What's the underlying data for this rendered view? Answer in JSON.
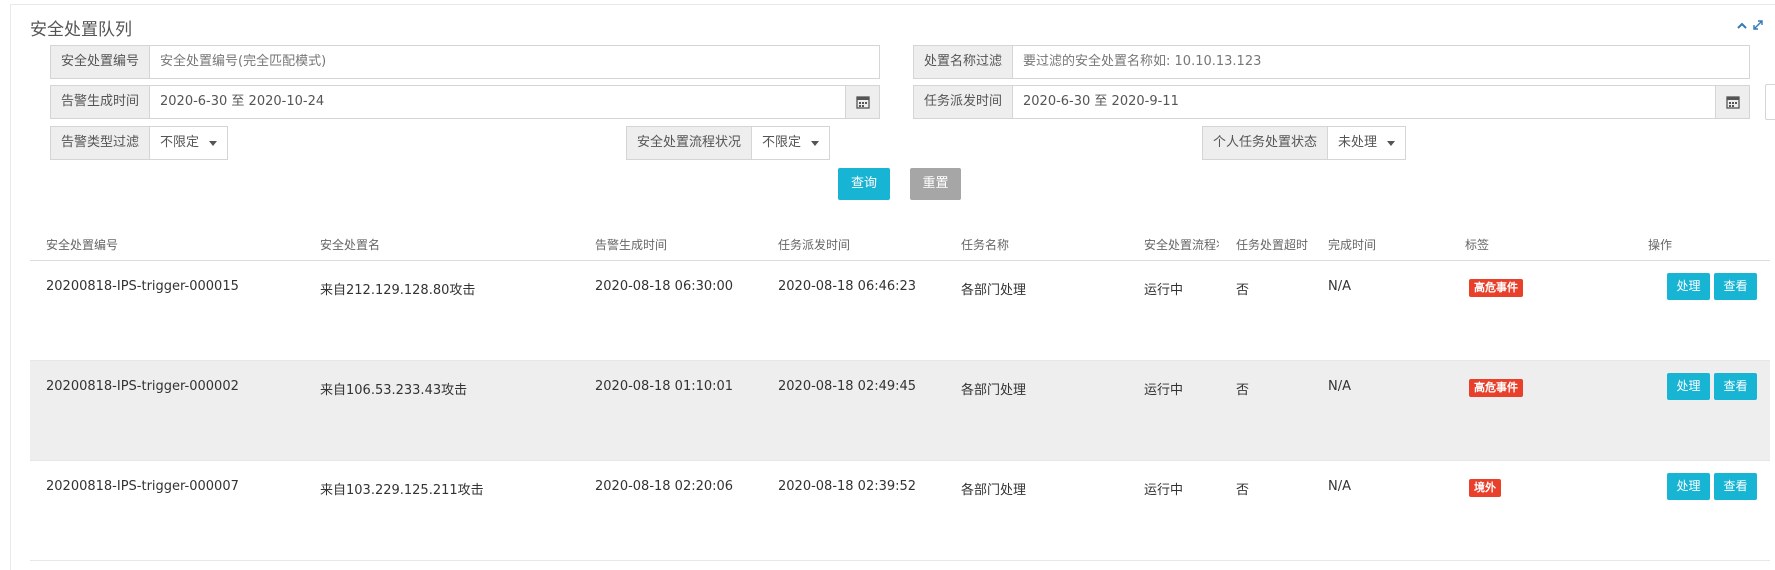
{
  "panel": {
    "title": "安全处置队列",
    "collapse_icon": "chevron-up-icon",
    "expand_icon": "expand-icon"
  },
  "filters": {
    "id": {
      "label": "安全处置编号",
      "placeholder": "安全处置编号(完全匹配模式)"
    },
    "name": {
      "label": "处置名称过滤",
      "placeholder": "要过滤的安全处置名称如: 10.10.13.123"
    },
    "alert_time": {
      "label": "告警生成时间",
      "value": "2020-6-30 至 2020-10-24"
    },
    "dispatch_time": {
      "label": "任务派发时间",
      "value": "2020-6-30 至 2020-9-11"
    },
    "alert_type": {
      "label": "告警类型过滤",
      "value": "不限定"
    },
    "flow_status": {
      "label": "安全处置流程状况",
      "value": "不限定"
    },
    "personal_status": {
      "label": "个人任务处置状态",
      "value": "未处理"
    }
  },
  "buttons": {
    "query": "查询",
    "reset": "重置"
  },
  "table": {
    "headers": [
      "安全处置编号",
      "安全处置名",
      "告警生成时间",
      "任务派发时间",
      "任务名称",
      "安全处置流程状",
      "任务处置超时",
      "完成时间",
      "标签",
      "操作"
    ],
    "rows": [
      {
        "id": "20200818-IPS-trigger-000015",
        "name": "来自212.129.128.80攻击",
        "alert_time": "2020-08-18 06:30:00",
        "dispatch_time": "2020-08-18 06:46:23",
        "task": "各部门处理",
        "status": "运行中",
        "timeout": "否",
        "done": "N/A",
        "tag": "高危事件"
      },
      {
        "id": "20200818-IPS-trigger-000002",
        "name": "来自106.53.233.43攻击",
        "alert_time": "2020-08-18 01:10:01",
        "dispatch_time": "2020-08-18 02:49:45",
        "task": "各部门处理",
        "status": "运行中",
        "timeout": "否",
        "done": "N/A",
        "tag": "高危事件"
      },
      {
        "id": "20200818-IPS-trigger-000007",
        "name": "来自103.229.125.211攻击",
        "alert_time": "2020-08-18 02:20:06",
        "dispatch_time": "2020-08-18 02:39:52",
        "task": "各部门处理",
        "status": "运行中",
        "timeout": "否",
        "done": "N/A",
        "tag": "境外"
      }
    ],
    "actions": {
      "handle": "处理",
      "view": "查看"
    }
  },
  "colors": {
    "primary": "#17b4d4",
    "reset": "#a6a6a6",
    "tag": "#e8402b",
    "alt_row": "#eeeeee"
  }
}
